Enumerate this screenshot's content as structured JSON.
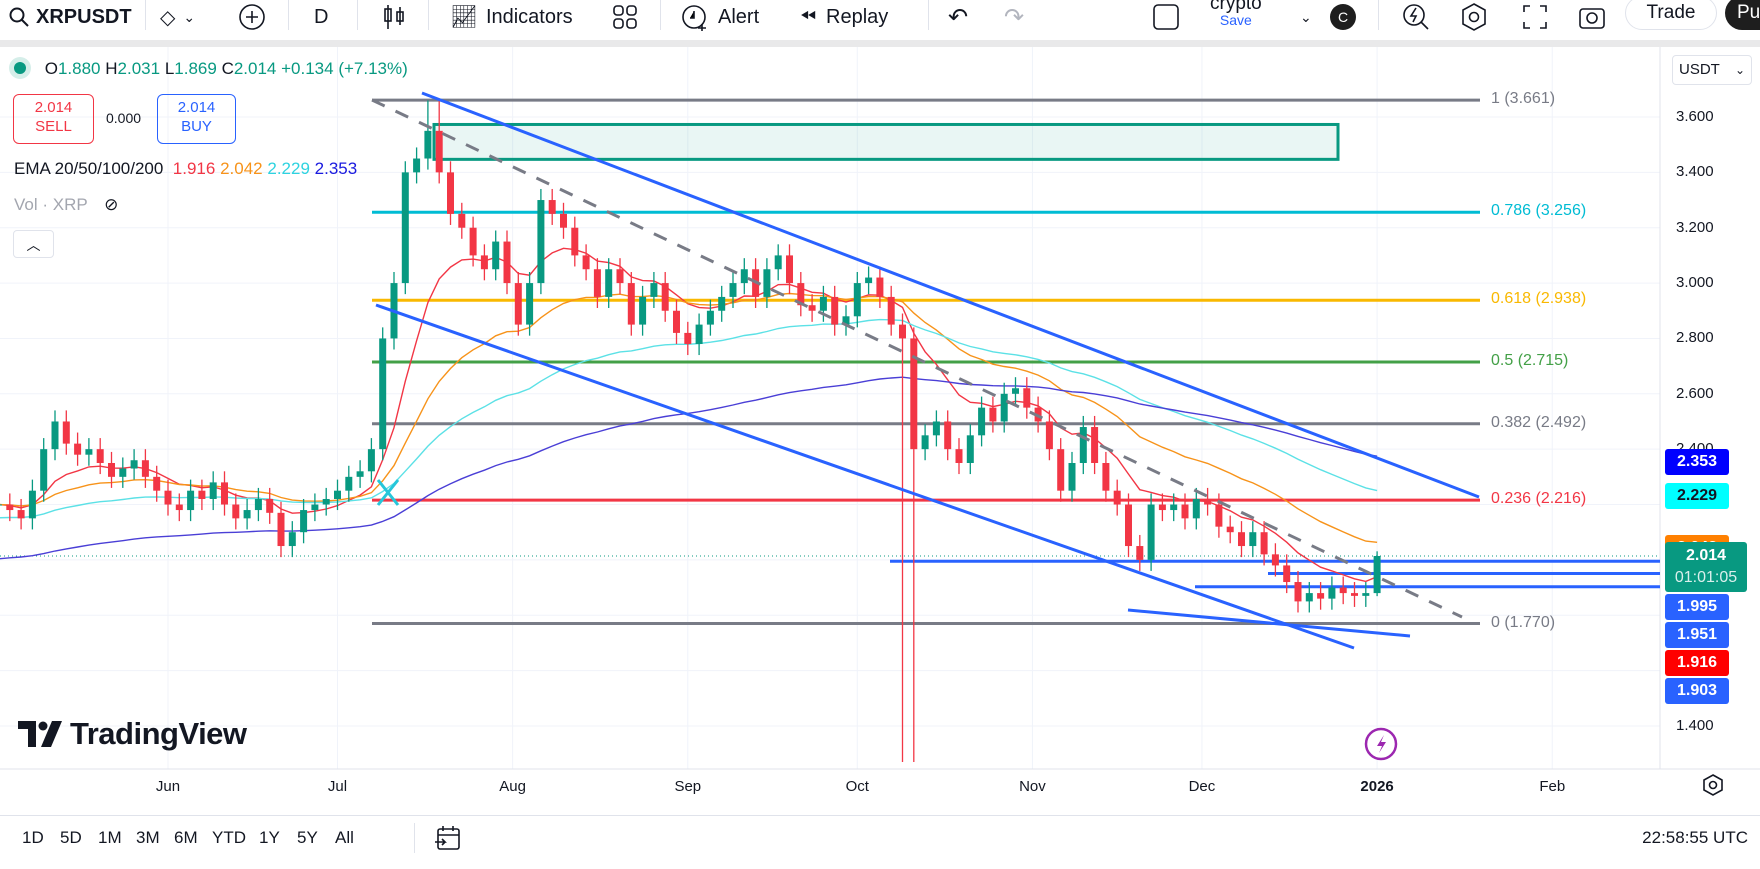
{
  "toolbar": {
    "symbol": "XRPUSDT",
    "interval": "D",
    "indicators": "Indicators",
    "alert": "Alert",
    "replay": "Replay",
    "layout_name": "crypto",
    "save": "Save",
    "avatar": "C",
    "trade": "Trade",
    "publish": "Pu"
  },
  "legend": {
    "open_label": "O",
    "open": "1.880",
    "high_label": "H",
    "high": "2.031",
    "low_label": "L",
    "low": "1.869",
    "close_label": "C",
    "close": "2.014",
    "change": "+0.134 (+7.13%)",
    "sell_price": "2.014",
    "sell_label": "SELL",
    "spread": "0.000",
    "buy_price": "2.014",
    "buy_label": "BUY",
    "ema_label": "EMA 20/50/100/200",
    "ema20": "1.916",
    "ema50": "2.042",
    "ema100": "2.229",
    "ema200": "2.353",
    "vol_label": "Vol · XRP"
  },
  "currency": "USDT",
  "colors": {
    "up": "#089981",
    "down": "#f23645",
    "ema20": "#f23645",
    "ema50": "#f7931a",
    "ema100": "#5ce1e6",
    "ema200": "#4a3fd6",
    "trend": "#2962ff",
    "zone": "#089981"
  },
  "chart_data": {
    "type": "candlestick",
    "symbol": "XRPUSDT",
    "interval_days": 2,
    "start_date": "2025-05-02",
    "closes": [
      2.2,
      2.18,
      2.15,
      2.25,
      2.4,
      2.5,
      2.42,
      2.38,
      2.4,
      2.35,
      2.3,
      2.33,
      2.36,
      2.3,
      2.25,
      2.2,
      2.18,
      2.25,
      2.22,
      2.28,
      2.2,
      2.15,
      2.18,
      2.22,
      2.17,
      2.05,
      2.1,
      2.18,
      2.2,
      2.22,
      2.25,
      2.3,
      2.32,
      2.4,
      2.8,
      3.0,
      3.4,
      3.45,
      3.55,
      3.4,
      3.25,
      3.2,
      3.1,
      3.05,
      3.15,
      3.0,
      2.85,
      3.0,
      3.3,
      3.25,
      3.2,
      3.1,
      3.05,
      2.95,
      3.05,
      3.0,
      2.85,
      2.95,
      3.0,
      2.9,
      2.82,
      2.78,
      2.85,
      2.9,
      2.95,
      3.0,
      3.05,
      2.95,
      3.05,
      3.1,
      3.0,
      2.92,
      2.9,
      2.95,
      2.85,
      2.88,
      3.0,
      3.02,
      2.95,
      2.85,
      2.8,
      2.4,
      2.45,
      2.5,
      2.4,
      2.35,
      2.45,
      2.55,
      2.5,
      2.6,
      2.62,
      2.55,
      2.5,
      2.4,
      2.25,
      2.35,
      2.48,
      2.35,
      2.25,
      2.2,
      2.05,
      2.0,
      2.2,
      2.18,
      2.2,
      2.15,
      2.22,
      2.2,
      2.12,
      2.1,
      2.05,
      2.1,
      2.02,
      1.98,
      1.92,
      1.85,
      1.88,
      1.86,
      1.9,
      1.88,
      1.87,
      1.88,
      2.014
    ],
    "last_open": 1.88,
    "last_high": 2.031,
    "last_low": 1.869,
    "notable_wicks": [
      {
        "date": "2025-07-18",
        "high": 3.66
      },
      {
        "date": "2025-10-10",
        "low": 1.27
      }
    ],
    "y_ticks": [
      "3.600",
      "3.400",
      "3.200",
      "3.000",
      "2.800",
      "2.600",
      "2.400",
      "1.400"
    ],
    "ylim": [
      1.27,
      3.75
    ],
    "x_ticks": [
      {
        "label": "Jun",
        "date": "2025-06-01"
      },
      {
        "label": "Jul",
        "date": "2025-07-01"
      },
      {
        "label": "Aug",
        "date": "2025-08-01"
      },
      {
        "label": "Sep",
        "date": "2025-09-01"
      },
      {
        "label": "Oct",
        "date": "2025-10-01"
      },
      {
        "label": "Nov",
        "date": "2025-11-01"
      },
      {
        "label": "Dec",
        "date": "2025-12-01"
      },
      {
        "label": "2026",
        "date": "2026-01-01"
      },
      {
        "label": "Feb",
        "date": "2026-02-01"
      }
    ],
    "fib_levels": [
      {
        "label": "1 (3.661)",
        "price": 3.661,
        "color": "#787b86"
      },
      {
        "label": "0.786 (3.256)",
        "price": 3.256,
        "color": "#00bcd4"
      },
      {
        "label": "0.618 (2.938)",
        "price": 2.938,
        "color": "#f9b800"
      },
      {
        "label": "0.5 (2.715)",
        "price": 2.715,
        "color": "#43a047"
      },
      {
        "label": "0.382 (2.492)",
        "price": 2.492,
        "color": "#787b86"
      },
      {
        "label": "0.236 (2.216)",
        "price": 2.216,
        "color": "#f23645"
      },
      {
        "label": "0 (1.770)",
        "price": 1.77,
        "color": "#787b86"
      }
    ],
    "zone": {
      "top": 3.573,
      "bottom": 3.447
    },
    "horizontal_levels": [
      1.995,
      1.951,
      1.903
    ],
    "price_badges": [
      {
        "value": "2.353",
        "bg": "#0000ff",
        "fg": "#ffffff",
        "price": 2.353
      },
      {
        "value": "2.229",
        "bg": "#00ffff",
        "fg": "#131722",
        "price": 2.229
      },
      {
        "value": "2.042",
        "bg": "#ff8000",
        "fg": "#ffffff",
        "price": 2.042
      },
      {
        "value": "1.995",
        "bg": "#2962ff",
        "fg": "#ffffff",
        "price": 1.995
      },
      {
        "value": "1.951",
        "bg": "#2962ff",
        "fg": "#ffffff",
        "price": 1.951
      },
      {
        "value": "1.916",
        "bg": "#ff0000",
        "fg": "#ffffff",
        "price": 1.916
      },
      {
        "value": "1.903",
        "bg": "#2962ff",
        "fg": "#ffffff",
        "price": 1.903
      }
    ],
    "last_price": {
      "value": "2.014",
      "countdown": "01:01:05",
      "bg": "#089981"
    }
  },
  "ranges": [
    "1D",
    "5D",
    "1M",
    "3M",
    "6M",
    "YTD",
    "1Y",
    "5Y",
    "All"
  ],
  "clock": "22:58:55 UTC",
  "logo": "TradingView"
}
